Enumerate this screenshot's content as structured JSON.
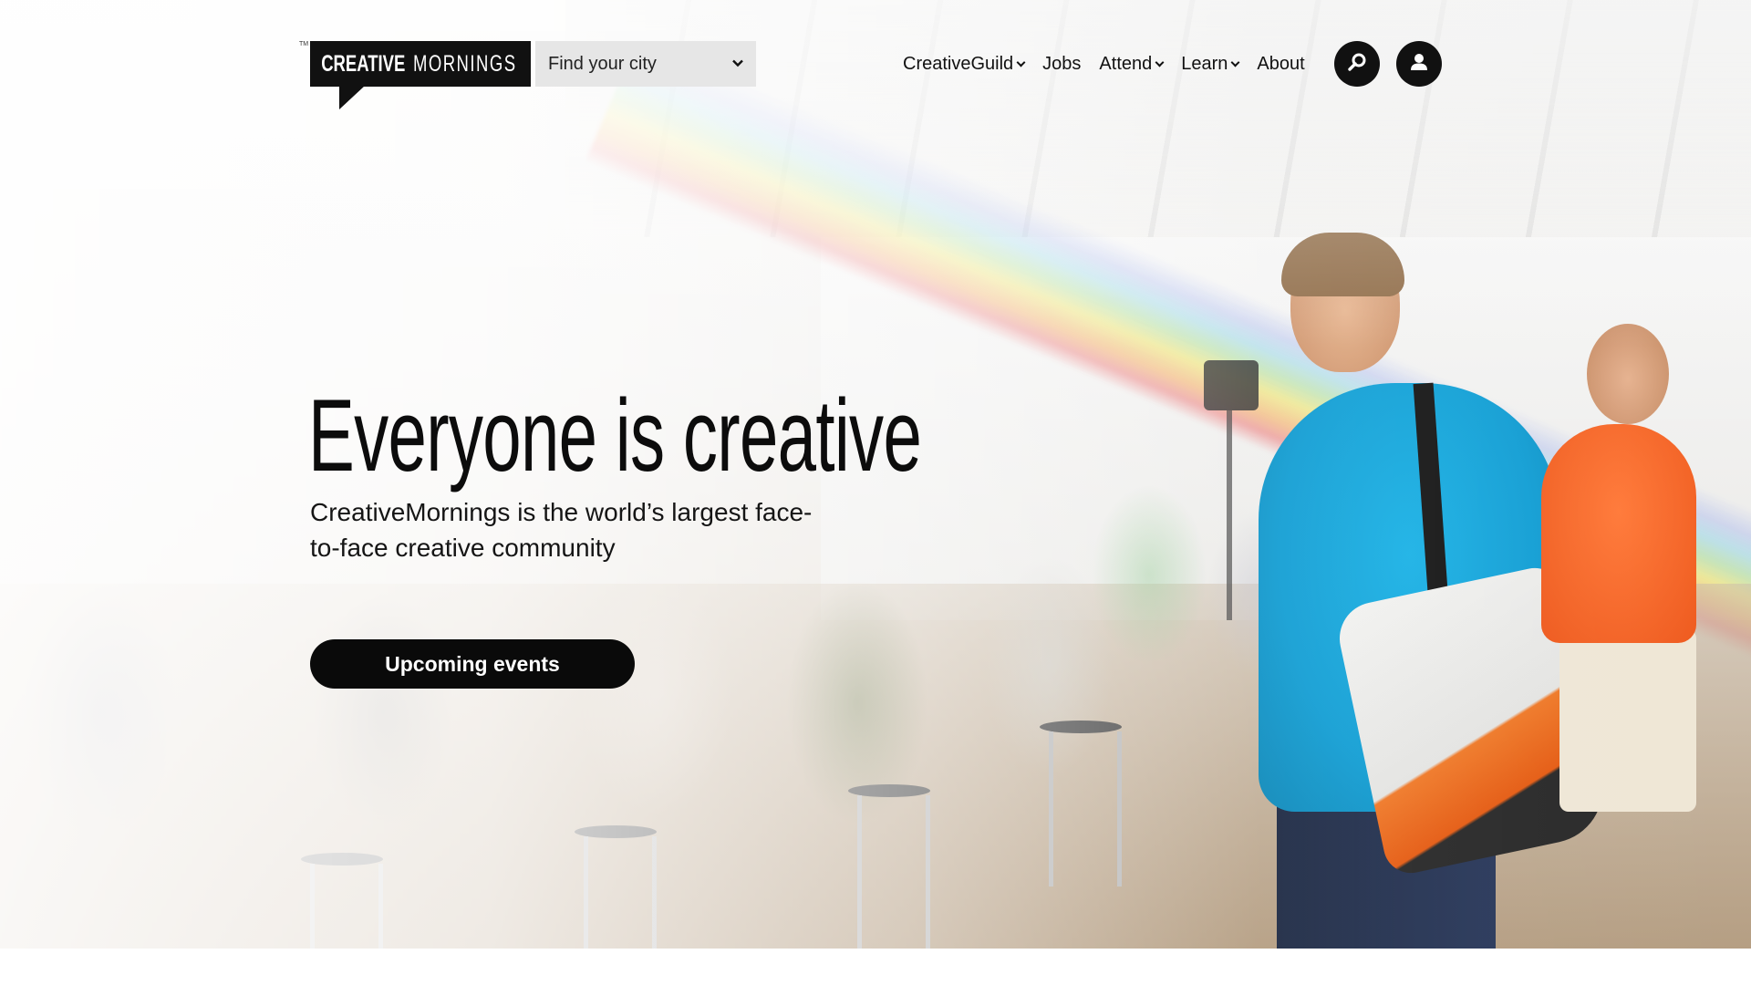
{
  "header": {
    "logo_bold": "CREATIVE",
    "logo_light": "MORNINGS",
    "logo_tm": "TM",
    "city_select": {
      "selected": "Find your city"
    },
    "nav": [
      {
        "label": "CreativeGuild",
        "has_dropdown": true
      },
      {
        "label": "Jobs",
        "has_dropdown": false
      },
      {
        "label": "Attend",
        "has_dropdown": true
      },
      {
        "label": "Learn",
        "has_dropdown": true
      },
      {
        "label": "About",
        "has_dropdown": false
      }
    ],
    "icons": {
      "search": "search-icon",
      "account": "user-icon"
    }
  },
  "hero": {
    "title": "Everyone is creative",
    "subtitle": "CreativeMornings is the world’s largest face-to-face creative community",
    "cta_label": "Upcoming events"
  },
  "colors": {
    "brand_black": "#111111",
    "select_bg": "#e6e6e6",
    "page_bg": "#ffffff"
  }
}
